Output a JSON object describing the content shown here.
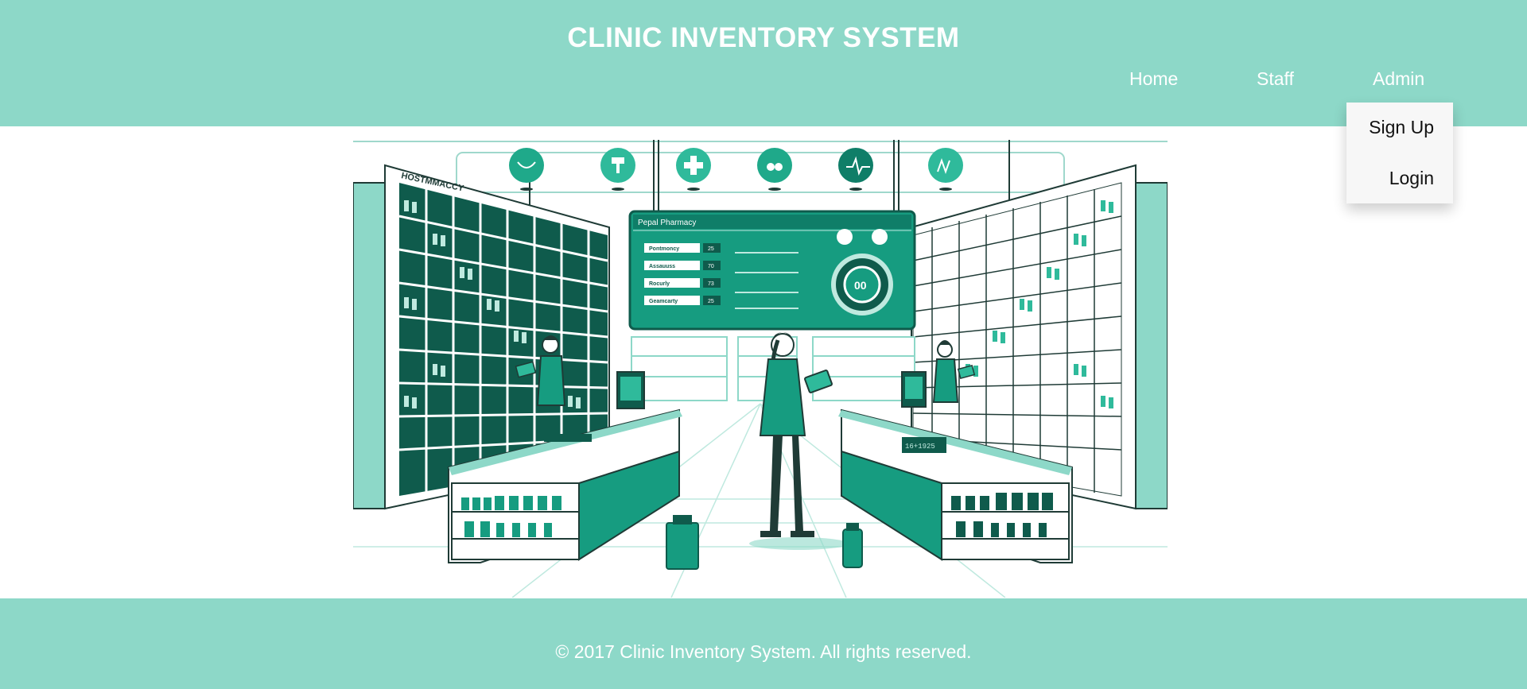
{
  "header": {
    "title": "CLINIC INVENTORY SYSTEM",
    "nav": {
      "home": "Home",
      "staff": "Staff",
      "admin": "Admin"
    },
    "admin_dropdown": {
      "signup": "Sign Up",
      "login": "Login"
    }
  },
  "hero": {
    "shelf_label": "HOSTMMACCY",
    "screen_title": "Pepal Pharmacy",
    "screen_rows": [
      "Pontmoncy",
      "Assauuss",
      "Rocurly",
      "Geamcarty"
    ],
    "screen_row_values": [
      "25",
      "70",
      "73",
      "25"
    ],
    "gauge_value": "00",
    "register_display": "16+1925"
  },
  "footer": {
    "copyright": "© 2017 Clinic Inventory System. All rights reserved."
  },
  "colors": {
    "header_bg": "#8dd8c8",
    "footer_bg": "#8dd8c8",
    "accent": "#169c80",
    "dark_teal": "#0f5b4c"
  }
}
